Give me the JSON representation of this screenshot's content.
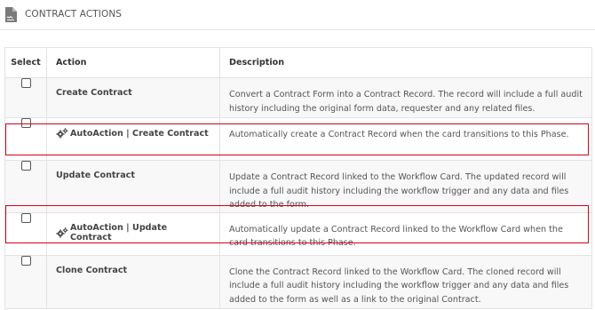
{
  "header": {
    "title": "CONTRACT ACTIONS",
    "icon": "document-signature-icon"
  },
  "table": {
    "columns": [
      "Select",
      "Action",
      "Description"
    ],
    "rows": [
      {
        "action": "Create Contract",
        "auto": false,
        "checked": false,
        "description": "Convert a Contract Form into a Contract Record. The record will include a full audit history including the original form data, requester and any related files.",
        "highlighted": false
      },
      {
        "action": "AutoAction | Create Contract",
        "auto": true,
        "checked": false,
        "description": "Automatically create a Contract Record when the card transitions to this Phase.",
        "highlighted": true
      },
      {
        "action": "Update Contract",
        "auto": false,
        "checked": false,
        "description": "Update a Contract Record linked to the Workflow Card. The updated record will include a full audit history including the workflow trigger and any data and files added to the form.",
        "highlighted": false
      },
      {
        "action": "AutoAction | Update Contract",
        "auto": true,
        "checked": false,
        "description": "Automatically update a Contract Record linked to the Workflow Card when the card transitions to this Phase.",
        "highlighted": true
      },
      {
        "action": "Clone Contract",
        "auto": false,
        "checked": false,
        "description": "Clone the Contract Record linked to the Workflow Card. The cloned record will include a full audit history including the workflow trigger and any data and files added to the form as well as a link to the original Contract.",
        "highlighted": false
      }
    ]
  },
  "colors": {
    "highlight": "#d0021b",
    "row_alt": "#f8f8f8",
    "border": "#e3e3e3"
  }
}
